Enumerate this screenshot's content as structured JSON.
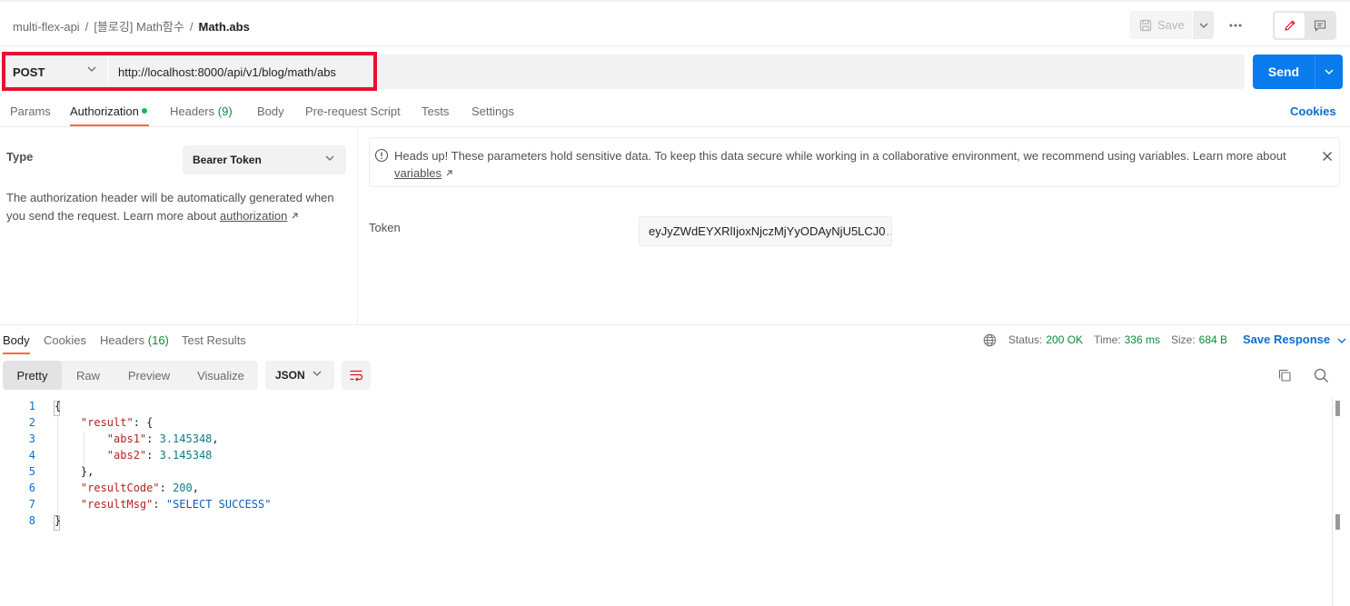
{
  "breadcrumb": {
    "workspace": "multi-flex-api",
    "folder": "[블로깅] Math함수",
    "request": "Math.abs",
    "separator": "/"
  },
  "toolbar": {
    "save_label": "Save",
    "more_label": "•••"
  },
  "request": {
    "method": "POST",
    "url": "http://localhost:8000/api/v1/blog/math/abs",
    "send_label": "Send"
  },
  "req_tabs": {
    "params": "Params",
    "authorization": "Authorization",
    "headers": "Headers",
    "headers_count": "(9)",
    "body": "Body",
    "prerequest": "Pre-request Script",
    "tests": "Tests",
    "settings": "Settings",
    "cookies": "Cookies"
  },
  "auth": {
    "type_label": "Type",
    "type_value": "Bearer Token",
    "description": "The authorization header will be automatically generated when you send the request. Learn more about ",
    "description_link": "authorization",
    "notice": "Heads up! These parameters hold sensitive data. To keep this data secure while working in a collaborative environment, we recommend using variables. Learn more about ",
    "notice_link": "variables",
    "token_label": "Token",
    "token_value": "eyJyZWdEYXRlIjoxNjczMjYyODAyNjU5LCJ0",
    "token_ellipsis": "..."
  },
  "response": {
    "tabs": {
      "body": "Body",
      "cookies": "Cookies",
      "headers": "Headers",
      "headers_count": "(16)",
      "test_results": "Test Results"
    },
    "status_label": "Status:",
    "status_value": "200 OK",
    "time_label": "Time:",
    "time_value": "336 ms",
    "size_label": "Size:",
    "size_value": "684 B",
    "save_response": "Save Response",
    "views": [
      "Pretty",
      "Raw",
      "Preview",
      "Visualize"
    ],
    "format": "JSON"
  },
  "code": {
    "line_numbers": [
      "1",
      "2",
      "3",
      "4",
      "5",
      "6",
      "7",
      "8"
    ],
    "open_brace": "{",
    "result_key": "\"result\"",
    "abs1_key": "\"abs1\"",
    "abs1_val": "3.145348",
    "abs2_key": "\"abs2\"",
    "abs2_val": "3.145348",
    "inner_close": "},",
    "resultcode_key": "\"resultCode\"",
    "resultcode_val": "200",
    "resultmsg_key": "\"resultMsg\"",
    "resultmsg_val": "\"SELECT SUCCESS\"",
    "close_brace": "}"
  },
  "colors": {
    "accent": "#097bed",
    "tab_underline": "#ff6c37",
    "highlight": "#e8102e",
    "success": "#0c8a3b"
  }
}
